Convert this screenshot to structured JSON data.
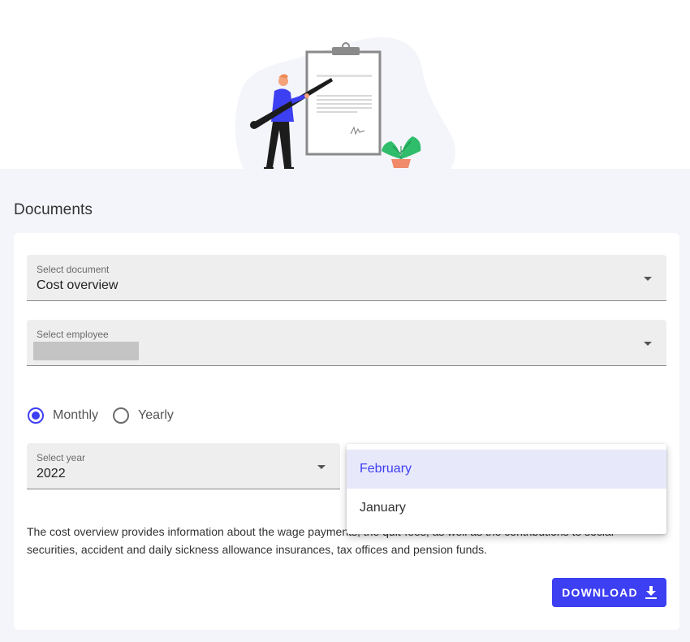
{
  "page": {
    "title": "Documents"
  },
  "form": {
    "document_select": {
      "label": "Select document",
      "value": "Cost overview"
    },
    "employee_select": {
      "label": "Select employee",
      "value": ""
    },
    "period": {
      "options": [
        {
          "label": "Monthly",
          "checked": true
        },
        {
          "label": "Yearly",
          "checked": false
        }
      ]
    },
    "year_select": {
      "label": "Select year",
      "value": "2022"
    },
    "month_dropdown": {
      "options": [
        {
          "label": "February",
          "selected": true
        },
        {
          "label": "January",
          "selected": false
        }
      ]
    },
    "description_line1": "The cost overview provides information about the wage payments, the quit-fees, as well as the contributions to social",
    "description_line2": "securities, accident and daily sickness allowance insurances, tax offices and pension funds.",
    "download_label": "DOWNLOAD"
  },
  "colors": {
    "accent": "#3d3ff2",
    "background": "#f4f5fa",
    "field": "#eeeeee"
  },
  "icons": [
    "download-icon",
    "caret-down-icon",
    "clipboard-illustration"
  ]
}
